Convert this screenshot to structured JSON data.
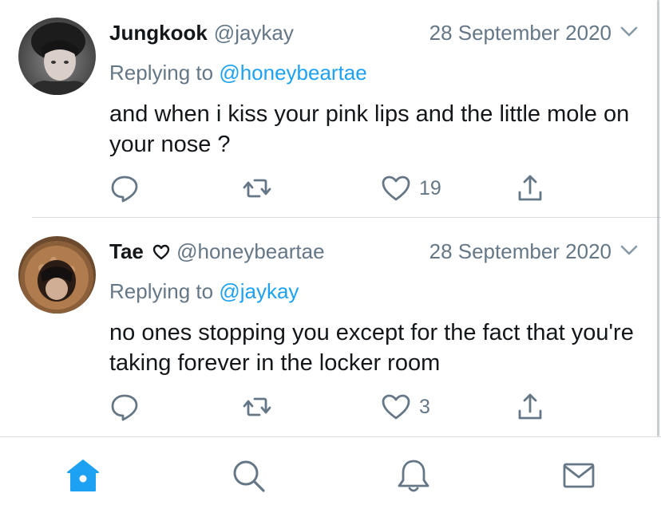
{
  "colors": {
    "accent": "#1da1f2",
    "muted": "#657786",
    "text": "#14171a",
    "divider": "#d8dde1"
  },
  "tweets": [
    {
      "name": "Jungkook",
      "handle": "@jaykay",
      "date": "28 September 2020",
      "replying_prefix": "Replying to",
      "replying_to": "@honeybeartae",
      "text": "and when i kiss your pink lips and the little mole on your nose ?",
      "likes": "19"
    },
    {
      "name": "Tae",
      "name_icon": "heart-outline-icon",
      "handle": "@honeybeartae",
      "date": "28 September 2020",
      "replying_prefix": "Replying to",
      "replying_to": "@jaykay",
      "text": "no ones stopping you except for the fact that you're taking forever in the locker room",
      "likes": "3"
    }
  ],
  "tabbar": {
    "items": [
      "home-icon",
      "search-icon",
      "notifications-icon",
      "messages-icon"
    ],
    "active": "home-icon"
  }
}
